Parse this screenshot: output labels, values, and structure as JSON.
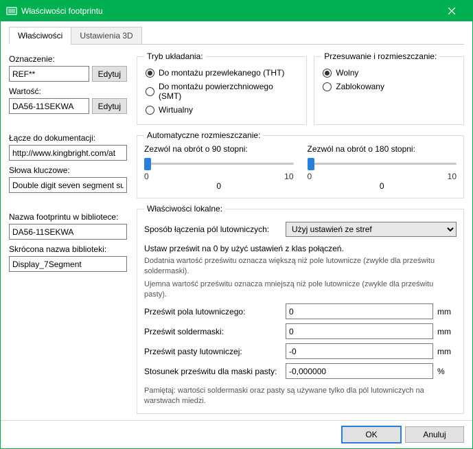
{
  "window": {
    "title": "Właściwości footprintu"
  },
  "tabs": {
    "properties": "Właściwości",
    "settings3d": "Ustawienia 3D"
  },
  "left": {
    "designator_label": "Oznaczenie:",
    "designator_value": "REF**",
    "edit": "Edytuj",
    "value_label": "Wartość:",
    "value_value": "DA56-11SEKWA",
    "doc_label": "Łącze do dokumentacji:",
    "doc_value": "http://www.kingbright.com/at",
    "keywords_label": "Słowa kluczowe:",
    "keywords_value": "Double digit seven segment su",
    "libname_label": "Nazwa footprintu w bibliotece:",
    "libname_value": "DA56-11SEKWA",
    "libshort_label": "Skrócona nazwa biblioteki:",
    "libshort_value": "Display_7Segment"
  },
  "placement": {
    "legend": "Tryb układania:",
    "tht": "Do montażu przewlekanego (THT)",
    "smt": "Do montażu powierzchniowego (SMT)",
    "virtual": "Wirtualny"
  },
  "move": {
    "legend": "Przesuwanie i rozmieszczanie:",
    "free": "Wolny",
    "locked": "Zablokowany"
  },
  "auto": {
    "legend": "Automatyczne rozmieszczanie:",
    "rot90_label": "Zezwól na obrót o 90 stopni:",
    "rot180_label": "Zezwól na obrót o 180 stopni:",
    "min": "0",
    "max": "10",
    "val": "0"
  },
  "local": {
    "legend": "Właściwości lokalne:",
    "pad_conn_label": "Sposób łączenia pól lutowniczych:",
    "pad_conn_value": "Użyj ustawień ze stref",
    "set_zero": "Ustaw prześwit na 0 by użyć ustawień z klas połączeń.",
    "note1": "Dodatnia wartość prześwitu oznacza większą niż pole lutownicze (zwykle dla prześwitu soldermaski).",
    "note2": "Ujemna wartość prześwitu oznacza mniejszą niż pole lutownicze (zwykle dla prześwitu pasty).",
    "pad_label": "Prześwit pola lutowniczego:",
    "pad_value": "0",
    "mask_label": "Prześwit soldermaski:",
    "mask_value": "0",
    "paste_label": "Prześwit pasty lutowniczej:",
    "paste_value": "-0",
    "ratio_label": "Stosunek prześwitu dla maski pasty:",
    "ratio_value": "-0,000000",
    "mm": "mm",
    "pct": "%",
    "note3": "Pamiętaj: wartości soldermaski oraz pasty są używane tylko dla pól lutowniczych na warstwach miedzi."
  },
  "buttons": {
    "ok": "OK",
    "cancel": "Anuluj"
  }
}
